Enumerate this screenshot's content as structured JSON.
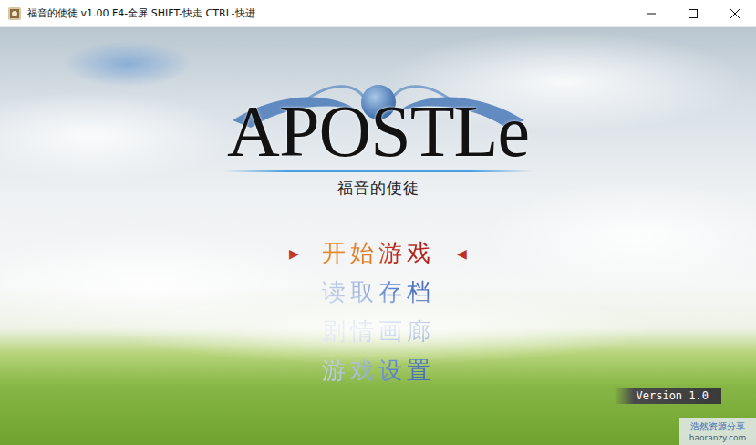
{
  "window": {
    "title": "福音的使徒 v1.00 F4-全屏 SHIFT-快走 CTRL-快进"
  },
  "logo": {
    "title": "APOSTLe",
    "subtitle": "福音的使徒"
  },
  "cursor": {
    "left": "▶",
    "right": "◀"
  },
  "menu": [
    {
      "label": "开始游戏",
      "selected": true
    },
    {
      "label": "读取存档",
      "selected": false
    },
    {
      "label": "剧情画廊",
      "selected": false
    },
    {
      "label": "游戏设置",
      "selected": false
    }
  ],
  "version": "Version 1.0",
  "watermark": {
    "name": "浩然资源分享",
    "url": "haoranzy.com"
  }
}
